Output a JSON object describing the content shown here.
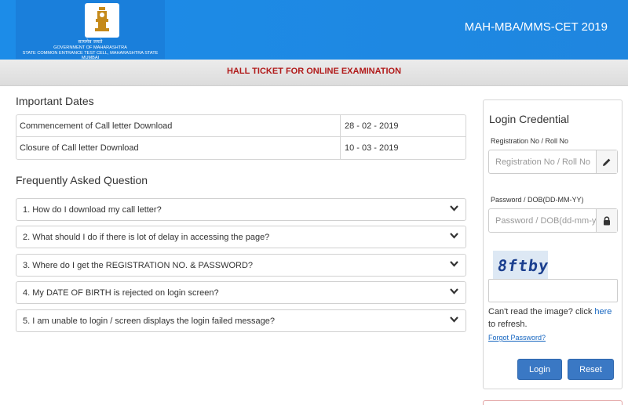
{
  "header": {
    "motto": "सत्यमेव जयते",
    "gov_line1": "GOVERNMENT OF MAHARASHTRA",
    "gov_line2": "STATE COMMON ENTRANCE TEST CELL, MAHARASHTRA STATE MUMBAI",
    "exam_title": "MAH-MBA/MMS-CET 2019"
  },
  "banner": {
    "title": "HALL TICKET FOR ONLINE EXAMINATION"
  },
  "important_dates": {
    "title": "Important Dates",
    "rows": [
      {
        "label": "Commencement of Call letter Download",
        "date": "28 - 02 - 2019"
      },
      {
        "label": "Closure of Call letter Download",
        "date": "10 - 03 - 2019"
      }
    ]
  },
  "faq": {
    "title": "Frequently Asked Question",
    "items": [
      "1. How do I download my call letter?",
      "2. What should I do if there is lot of delay in accessing the page?",
      "3. Where do I get the REGISTRATION NO. & PASSWORD?",
      "4. My DATE OF BIRTH is rejected on login screen?",
      "5. I am unable to login / screen displays the login failed message?"
    ]
  },
  "login": {
    "title": "Login Credential",
    "reg_label": "Registration No / Roll No",
    "reg_placeholder": "Registration No / Roll No",
    "pass_label": "Password / DOB(DD-MM-YY)",
    "pass_placeholder": "Password / DOB(dd-mm-yy)",
    "captcha_text": "8ftby",
    "cant_read_prefix": "Can't read the image? click ",
    "cant_read_link": "here",
    "cant_read_suffix": " to refresh.",
    "forgot": "Forgot Password?",
    "login_button": "Login",
    "reset_button": "Reset"
  },
  "colors": {
    "header_blue": "#1c8ce8",
    "banner_red": "#b11a1a",
    "button_blue": "#3a78c4",
    "link_blue": "#1565c0"
  },
  "icons": {
    "emblem": "state-emblem-icon",
    "faq_chevron": "chevron-down-icon",
    "reg_addon": "pencil-icon",
    "pass_addon": "lock-icon"
  }
}
